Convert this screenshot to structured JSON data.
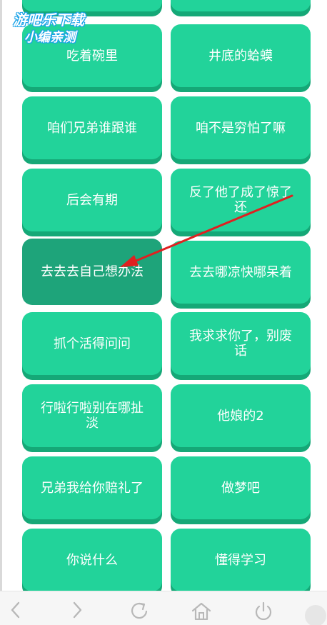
{
  "watermark": {
    "line1": "游吧乐下载",
    "line2": "小编亲测"
  },
  "buttons": [
    {
      "label": ""
    },
    {
      "label": ""
    },
    {
      "label": "吃着碗里"
    },
    {
      "label": "井底的蛤蟆"
    },
    {
      "label": "咱们兄弟谁跟谁"
    },
    {
      "label": "咱不是穷怕了嘛"
    },
    {
      "label": "后会有期"
    },
    {
      "label": "反了他了成了惊了还"
    },
    {
      "label": "去去去自己想办法"
    },
    {
      "label": "去去哪凉快哪呆着"
    },
    {
      "label": "抓个活得问问"
    },
    {
      "label": "我求求你了，别废话"
    },
    {
      "label": "行啦行啦别在哪扯淡"
    },
    {
      "label": "他娘的2"
    },
    {
      "label": "兄弟我给你赔礼了"
    },
    {
      "label": "做梦吧"
    },
    {
      "label": "你说什么"
    },
    {
      "label": "懂得学习"
    }
  ],
  "colors": {
    "button": "#22d39a",
    "button_shadow": "#15a877",
    "button_pressed": "#1ea47a",
    "annotation_arrow": "#e02020"
  },
  "navbar": {
    "icons": [
      "back-icon",
      "forward-icon",
      "refresh-icon",
      "home-icon",
      "power-icon",
      "menu-icon"
    ]
  }
}
